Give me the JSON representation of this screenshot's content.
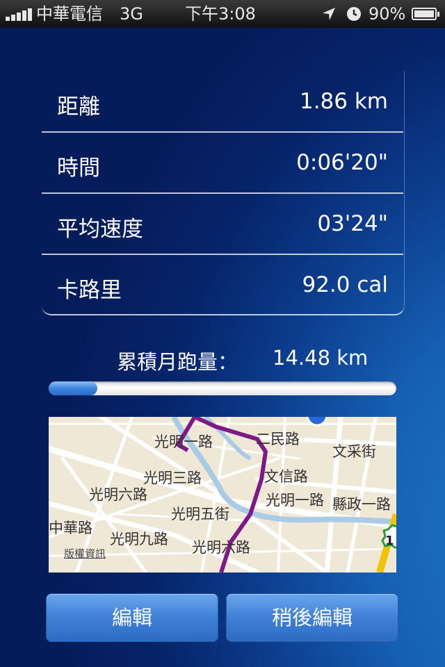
{
  "status_bar": {
    "carrier": "中華電信",
    "network": "3G",
    "time": "下午3:08",
    "battery": "90%"
  },
  "stats": [
    {
      "label": "距離",
      "value": "1.86 km"
    },
    {
      "label": "時間",
      "value": "0:06'20\""
    },
    {
      "label": "平均速度",
      "value": "03'24\""
    },
    {
      "label": "卡路里",
      "value": "92.0 cal"
    }
  ],
  "monthly": {
    "label": "累積月跑量：",
    "value": "14.48 km",
    "progress_fraction": 0.14
  },
  "map": {
    "road_labels": [
      "光明一路",
      "二民路",
      "文信路",
      "光明一路",
      "光明三路",
      "光明六路",
      "光明五街",
      "光明九路",
      "光明六路",
      "中華路",
      "縣政一路",
      "文采街"
    ],
    "copyright": "版權資訊",
    "route_color": "#7e1a86",
    "shield_number": "1"
  },
  "buttons": {
    "edit": "編輯",
    "edit_later": "稍後編輯"
  }
}
